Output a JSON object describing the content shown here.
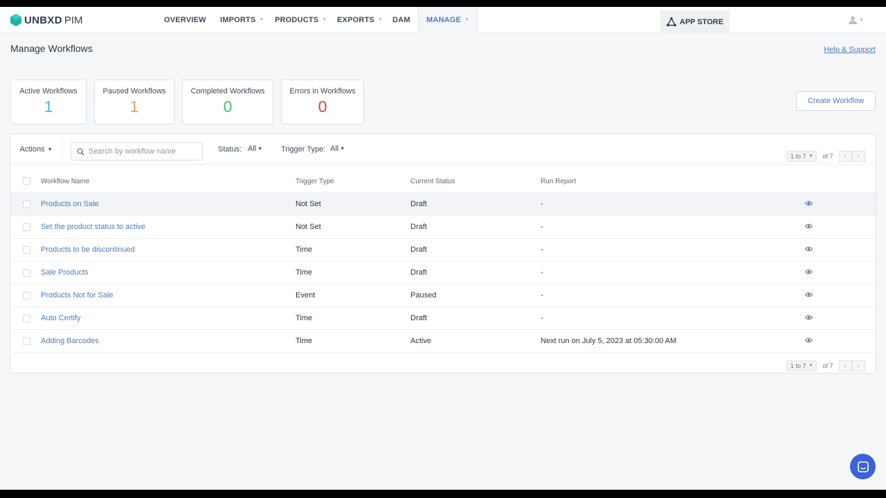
{
  "nav": {
    "brand": "UNBXD",
    "product": "PIM",
    "items": [
      {
        "label": "OVERVIEW",
        "has_caret": false
      },
      {
        "label": "IMPORTS",
        "has_caret": true
      },
      {
        "label": "PRODUCTS",
        "has_caret": true
      },
      {
        "label": "EXPORTS",
        "has_caret": true
      },
      {
        "label": "DAM",
        "has_caret": false
      },
      {
        "label": "MANAGE",
        "has_caret": true,
        "active": true
      }
    ],
    "app_store": "APP STORE",
    "icons": {
      "logo": "hexagon-logo-icon",
      "app_store": "app-store-icon",
      "user": "user-avatar-icon"
    }
  },
  "page": {
    "title": "Manage Workflows",
    "help_link": "Help & Support"
  },
  "stats": [
    {
      "label": "Active Workflows",
      "value": "1",
      "color": "#5bb4d9"
    },
    {
      "label": "Paused Workflows",
      "value": "1",
      "color": "#e3a25a"
    },
    {
      "label": "Completed Workflows",
      "value": "0",
      "color": "#4cc27a"
    },
    {
      "label": "Errors in Workflows",
      "value": "0",
      "color": "#d9453d"
    }
  ],
  "create_button": "Create Workflow",
  "toolbar": {
    "actions_label": "Actions",
    "search_placeholder": "Search by workflow name",
    "status_label": "Status:",
    "status_value": "All",
    "trigger_label": "Trigger Type:",
    "trigger_value": "All"
  },
  "pagination": {
    "range": "1 to 7",
    "of_label": "of 7"
  },
  "table": {
    "headers": [
      "Workflow Name",
      "Trigger Type",
      "Current Status",
      "Run Report"
    ],
    "rows": [
      {
        "name": "Products on Sale",
        "trigger": "Not Set",
        "status": "Draft",
        "report": "-"
      },
      {
        "name": "Set the product status to active",
        "trigger": "Not Set",
        "status": "Draft",
        "report": "-"
      },
      {
        "name": "Products to be discontinued",
        "trigger": "Time",
        "status": "Draft",
        "report": "-"
      },
      {
        "name": "Sale Products",
        "trigger": "Time",
        "status": "Draft",
        "report": "-"
      },
      {
        "name": "Products Not for Sale",
        "trigger": "Event",
        "status": "Paused",
        "report": "-"
      },
      {
        "name": "Auto Certify",
        "trigger": "Time",
        "status": "Draft",
        "report": "-"
      },
      {
        "name": "Adding Barcodes",
        "trigger": "Time",
        "status": "Active",
        "report": "Next run on July 5, 2023 at 05:30:00 AM"
      }
    ]
  },
  "colors": {
    "accent": "#4d7bc2",
    "chat_button": "#3b63d6"
  }
}
